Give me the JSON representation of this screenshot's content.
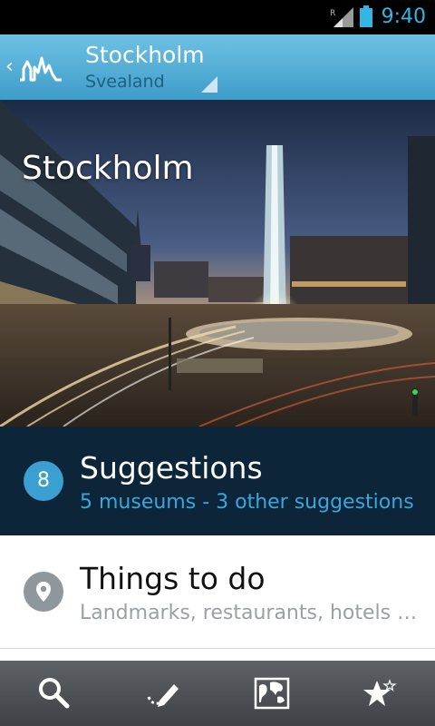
{
  "status_bar": {
    "time": "9:40",
    "network_label": "R",
    "accent_color": "#33b5e5"
  },
  "app_bar": {
    "title": "Stockholm",
    "subtitle": "Svealand",
    "bg_color": "#4fadd7"
  },
  "hero": {
    "title": "Stockholm"
  },
  "suggestions": {
    "count": "8",
    "heading": "Suggestions",
    "summary": "5 museums - 3 other suggestions"
  },
  "things_to_do": {
    "heading": "Things to do",
    "summary": "Landmarks, restaurants, hotels …"
  },
  "bottom_nav": {
    "items": [
      {
        "icon": "search-icon"
      },
      {
        "icon": "edit-route-icon"
      },
      {
        "icon": "map-icon"
      },
      {
        "icon": "favorites-star-icon"
      }
    ]
  }
}
